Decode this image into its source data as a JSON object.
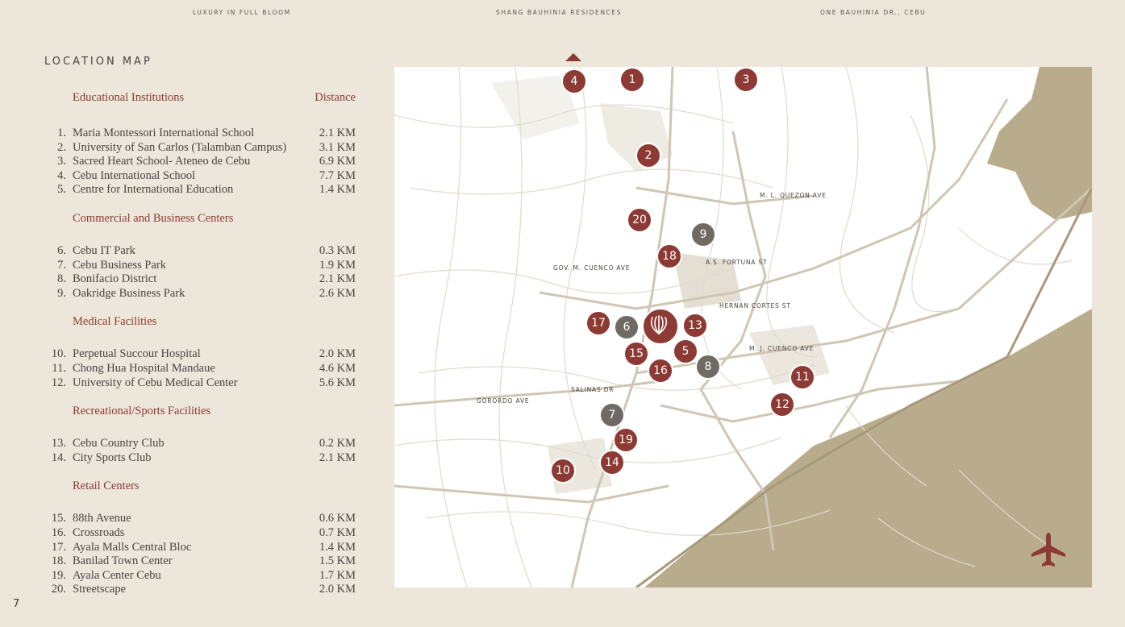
{
  "header": {
    "left": "LUXURY IN FULL BLOOM",
    "center": "SHANG BAUHINIA RESIDENCES",
    "right": "ONE BAUHINIA DR., CEBU"
  },
  "title": "LOCATION MAP",
  "page_number": "7",
  "distance_label": "Distance",
  "categories": [
    {
      "name": "Educational Institutions",
      "items": [
        {
          "num": "1.",
          "name": "Maria Montessori International School",
          "dist": "2.1 KM"
        },
        {
          "num": "2.",
          "name": "University of San Carlos (Talamban Campus)",
          "dist": "3.1 KM"
        },
        {
          "num": "3.",
          "name": "Sacred Heart School- Ateneo de Cebu",
          "dist": "6.9 KM"
        },
        {
          "num": "4.",
          "name": "Cebu International School",
          "dist": "7.7 KM"
        },
        {
          "num": "5.",
          "name": "Centre for International Education",
          "dist": "1.4 KM"
        }
      ]
    },
    {
      "name": "Commercial and Business Centers",
      "items": [
        {
          "num": "6.",
          "name": "Cebu IT Park",
          "dist": "0.3 KM"
        },
        {
          "num": "7.",
          "name": "Cebu Business Park",
          "dist": "1.9 KM"
        },
        {
          "num": "8.",
          "name": "Bonifacio District",
          "dist": "2.1 KM"
        },
        {
          "num": "9.",
          "name": "Oakridge Business Park",
          "dist": "2.6 KM"
        }
      ]
    },
    {
      "name": "Medical Facilities",
      "items": [
        {
          "num": "10.",
          "name": "Perpetual Succour Hospital",
          "dist": "2.0 KM"
        },
        {
          "num": "11.",
          "name": "Chong Hua Hospital Mandaue",
          "dist": "4.6 KM"
        },
        {
          "num": "12.",
          "name": "University of Cebu Medical Center",
          "dist": "5.6 KM"
        }
      ]
    },
    {
      "name": "Recreational/Sports Facilities",
      "items": [
        {
          "num": "13.",
          "name": "Cebu Country Club",
          "dist": "0.2 KM"
        },
        {
          "num": "14.",
          "name": "City Sports Club",
          "dist": "2.1 KM"
        }
      ]
    },
    {
      "name": "Retail Centers",
      "items": [
        {
          "num": "15.",
          "name": "88th Avenue",
          "dist": "0.6 KM"
        },
        {
          "num": "16.",
          "name": "Crossroads",
          "dist": "0.7 KM"
        },
        {
          "num": "17.",
          "name": "Ayala Malls Central Bloc",
          "dist": "1.4 KM"
        },
        {
          "num": "18.",
          "name": "Banilad Town Center",
          "dist": "1.5 KM"
        },
        {
          "num": "19.",
          "name": "Ayala Center Cebu",
          "dist": "1.7 KM"
        },
        {
          "num": "20.",
          "name": "Streetscape",
          "dist": "2.0 KM"
        }
      ]
    }
  ],
  "streets": [
    "M. L. QUEZON AVE",
    "GOV. M. CUENCO AVE",
    "A.S. FORTUNA ST",
    "HERNAN CORTES ST",
    "M. J. CUENCO AVE",
    "SALINAS DR",
    "GORORDO AVE"
  ],
  "markers": [
    {
      "label": "4",
      "color": "red"
    },
    {
      "label": "1",
      "color": "red"
    },
    {
      "label": "3",
      "color": "red"
    },
    {
      "label": "2",
      "color": "red"
    },
    {
      "label": "20",
      "color": "red"
    },
    {
      "label": "9",
      "color": "grey"
    },
    {
      "label": "18",
      "color": "red"
    },
    {
      "label": "17",
      "color": "red"
    },
    {
      "label": "6",
      "color": "grey"
    },
    {
      "label": "13",
      "color": "red"
    },
    {
      "label": "15",
      "color": "red"
    },
    {
      "label": "5",
      "color": "red"
    },
    {
      "label": "8",
      "color": "grey"
    },
    {
      "label": "16",
      "color": "red"
    },
    {
      "label": "11",
      "color": "red"
    },
    {
      "label": "12",
      "color": "red"
    },
    {
      "label": "7",
      "color": "grey"
    },
    {
      "label": "19",
      "color": "red"
    },
    {
      "label": "14",
      "color": "red"
    },
    {
      "label": "10",
      "color": "red"
    }
  ],
  "colors": {
    "background": "#ede6db",
    "accent": "#8c3a33",
    "marker_grey": "#6f6b64",
    "water": "#b9ac8c",
    "road": "#cfc6b3"
  }
}
